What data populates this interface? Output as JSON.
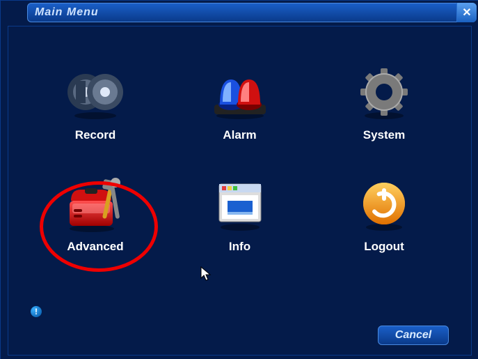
{
  "window": {
    "title": "Main Menu"
  },
  "menu": {
    "items": [
      {
        "id": "record",
        "label": "Record"
      },
      {
        "id": "alarm",
        "label": "Alarm"
      },
      {
        "id": "system",
        "label": "System"
      },
      {
        "id": "advanced",
        "label": "Advanced",
        "highlighted": true
      },
      {
        "id": "info",
        "label": "Info"
      },
      {
        "id": "logout",
        "label": "Logout"
      }
    ]
  },
  "buttons": {
    "cancel": "Cancel"
  },
  "info_badge": "!"
}
